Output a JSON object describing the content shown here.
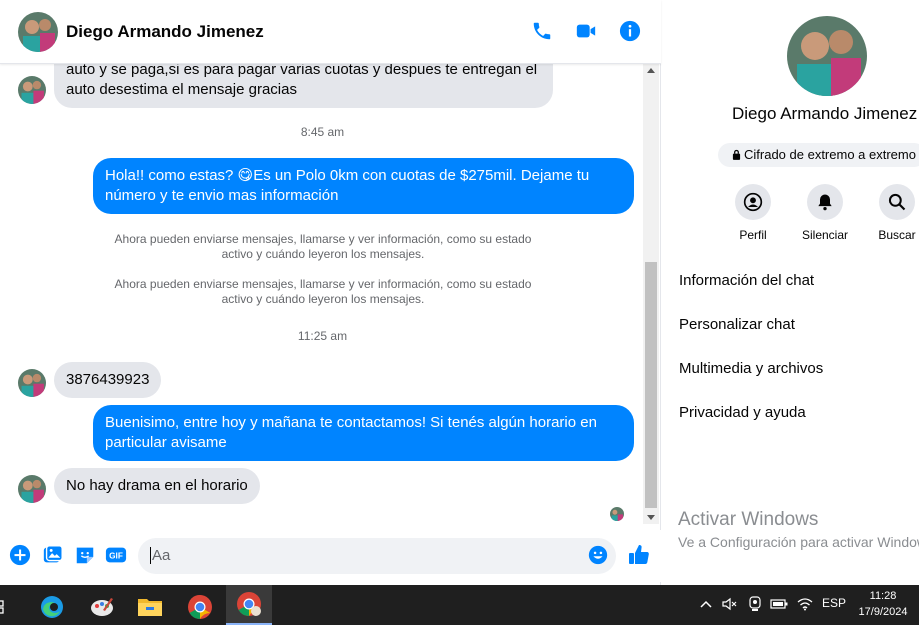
{
  "header": {
    "contact_name": "Diego Armando Jimenez"
  },
  "messages": {
    "first_in": "auto y se paga,si es para pagar varias cuotas y despues te entregan el auto desestima el mensaje gracias",
    "ts1": "8:45 am",
    "out1": "Hola!! como estas? 😋Es un Polo 0km con cuotas de $275mil. Dejame tu número y te envio mas información",
    "sys1": "Ahora pueden enviarse mensajes, llamarse y ver información, como su estado activo y cuándo leyeron los mensajes.",
    "sys2": "Ahora pueden enviarse mensajes, llamarse y ver información, como su estado activo y cuándo leyeron los mensajes.",
    "ts2": "11:25 am",
    "in2": "3876439923",
    "out2": "Buenisimo, entre hoy y mañana te contactamos! Si tenés algún horario en particular avisame",
    "in3": "No hay drama en el horario"
  },
  "composer": {
    "placeholder": "Aa"
  },
  "sidebar": {
    "name": "Diego Armando Jimenez",
    "encryption": "Cifrado de extremo a extremo",
    "actions": [
      {
        "label": "Perfil",
        "icon": "profile-icon"
      },
      {
        "label": "Silenciar",
        "icon": "bell-icon"
      },
      {
        "label": "Buscar",
        "icon": "search-icon"
      }
    ],
    "menu": [
      "Información del chat",
      "Personalizar chat",
      "Multimedia y archivos",
      "Privacidad y ayuda"
    ],
    "watermark_title": "Activar Windows",
    "watermark_sub": "Ve a Configuración para activar Windows."
  },
  "taskbar": {
    "language": "ESP",
    "time": "11:28",
    "date": "17/9/2024"
  },
  "colors": {
    "accent": "#0084ff",
    "bubble_in": "#e4e6eb",
    "taskbar": "#1f1f1f"
  }
}
